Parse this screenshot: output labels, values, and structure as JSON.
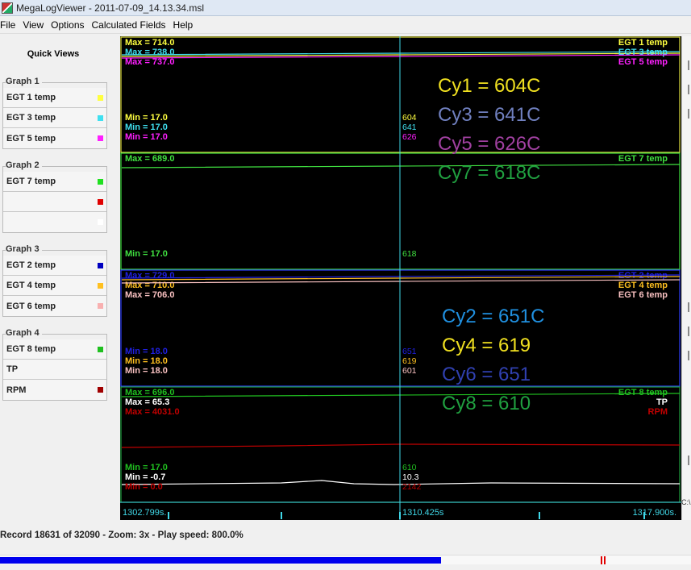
{
  "window": {
    "title": "MegaLogViewer - 2011-07-09_14.13.34.msl"
  },
  "menu": [
    {
      "label": "File"
    },
    {
      "label": "View"
    },
    {
      "label": "Options"
    },
    {
      "label": "Calculated Fields"
    },
    {
      "label": "Help"
    }
  ],
  "sidebar": {
    "quick_views": "Quick Views",
    "groups": [
      {
        "title": "Graph 1",
        "fields": [
          {
            "label": "EGT 1 temp",
            "color": "#ffff40"
          },
          {
            "label": "EGT 3 temp",
            "color": "#40e0f0"
          },
          {
            "label": "EGT 5 temp",
            "color": "#ff20ff"
          }
        ]
      },
      {
        "title": "Graph 2",
        "fields": [
          {
            "label": "EGT 7 temp",
            "color": "#20e020"
          },
          {
            "label": "",
            "color": "#e00000"
          },
          {
            "label": "",
            "color": "#ffffff"
          }
        ]
      },
      {
        "title": "Graph 3",
        "fields": [
          {
            "label": "EGT 2 temp",
            "color": "#0000c0"
          },
          {
            "label": "EGT 4 temp",
            "color": "#ffc020"
          },
          {
            "label": "EGT 6 temp",
            "color": "#f8b0b0"
          }
        ]
      },
      {
        "title": "Graph 4",
        "fields": [
          {
            "label": "EGT 8 temp",
            "color": "#20c020"
          },
          {
            "label": "TP",
            "color": ""
          },
          {
            "label": "RPM",
            "color": "#a00000"
          }
        ]
      }
    ]
  },
  "graphs": [
    {
      "border_color": "#e0e040",
      "series": [
        {
          "name": "EGT 1 temp",
          "color": "#ffff40",
          "max_label": "Max = 714.0",
          "min_label": "Min = 17.0",
          "cursor_value": "604"
        },
        {
          "name": "EGT 3 temp",
          "color": "#40e0f0",
          "max_label": "Max = 738.0",
          "min_label": "Min = 17.0",
          "cursor_value": "641"
        },
        {
          "name": "EGT 5 temp",
          "color": "#ff20ff",
          "max_label": "Max = 737.0",
          "min_label": "Min = 17.0",
          "cursor_value": "626"
        }
      ]
    },
    {
      "border_color": "#40e040",
      "series": [
        {
          "name": "EGT 7 temp",
          "color": "#40e040",
          "max_label": "Max = 689.0",
          "min_label": "Min = 17.0",
          "cursor_value": "618"
        }
      ]
    },
    {
      "border_color": "#3040ff",
      "series": [
        {
          "name": "EGT 2 temp",
          "color": "#2020e0",
          "max_label": "Max = 729.0",
          "min_label": "Min = 18.0",
          "cursor_value": "651"
        },
        {
          "name": "EGT 4 temp",
          "color": "#ffc020",
          "max_label": "Max = 710.0",
          "min_label": "Min = 18.0",
          "cursor_value": "619"
        },
        {
          "name": "EGT 6 temp",
          "color": "#f8c0c0",
          "max_label": "Max = 706.0",
          "min_label": "Min = 18.0",
          "cursor_value": "601"
        }
      ]
    },
    {
      "border_color": "#20a040",
      "series": [
        {
          "name": "EGT 8 temp",
          "color": "#20c020",
          "max_label": "Max = 696.0",
          "min_label": "Min = 17.0",
          "cursor_value": "610"
        },
        {
          "name": "TP",
          "color": "#ffffff",
          "max_label": "Max = 65.3",
          "min_label": "Min = -0.7",
          "cursor_value": "10.3"
        },
        {
          "name": "RPM",
          "color": "#c00000",
          "max_label": "Max = 4031.0",
          "min_label": "Min = 0.0",
          "cursor_value": "2142"
        }
      ]
    }
  ],
  "time_axis": {
    "start": "1302.799s.",
    "cursor": "1310.425s",
    "end": "1317.900s."
  },
  "annotations": [
    {
      "text": "Cy1 = 604C",
      "color": "#f0e020"
    },
    {
      "text": "Cy3 = 641C",
      "color": "#7080c0"
    },
    {
      "text": "Cy5 = 626C",
      "color": "#a040a0"
    },
    {
      "text": "Cy7 = 618C",
      "color": "#20a040"
    },
    {
      "text": "Cy2 = 651C",
      "color": "#2090e0"
    },
    {
      "text": "Cy4 = 619",
      "color": "#f0e020"
    },
    {
      "text": "Cy6 = 651",
      "color": "#3040b0"
    },
    {
      "text": "Cy8 = 610",
      "color": "#20a040"
    }
  ],
  "right_edge_label": "C:\\",
  "status": {
    "text": "Record 18631 of 32090 - Zoom: 3x - Play speed: 800.0%",
    "progress_fraction": 0.58,
    "marker_positions": [
      0.869,
      0.874
    ]
  }
}
